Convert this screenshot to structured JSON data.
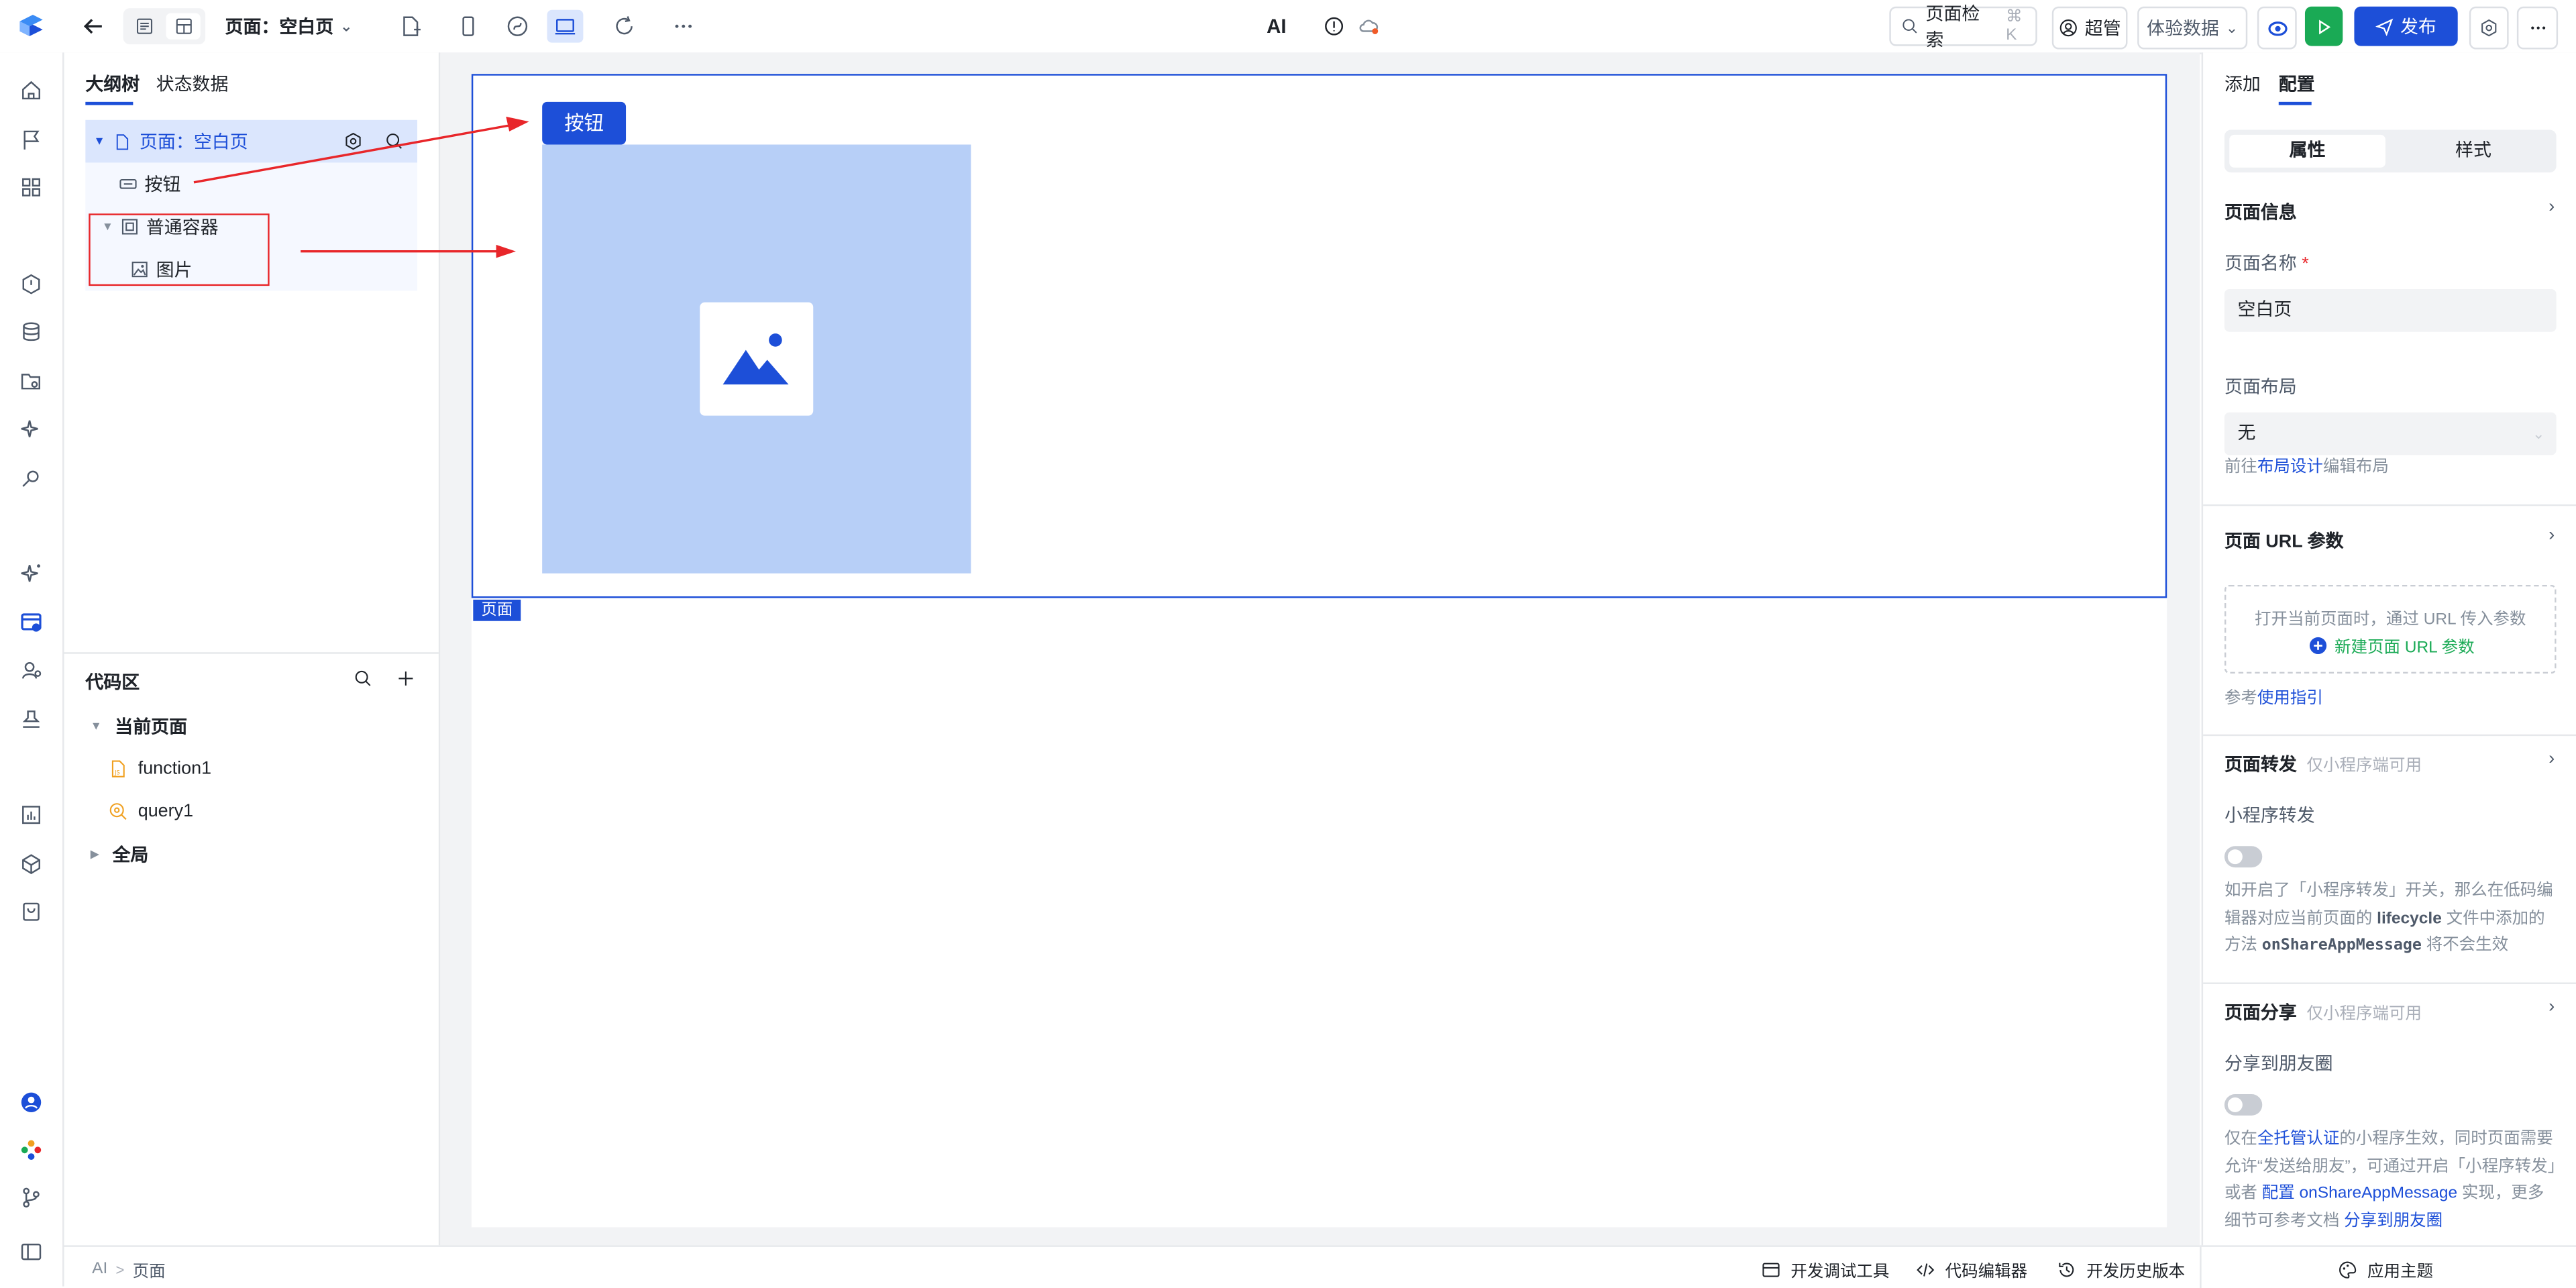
{
  "topbar": {
    "page_selector": "页面：空白页",
    "ai_label": "AI",
    "search_label": "页面检索",
    "search_shortcut": "⌘ K",
    "user_label": "超管",
    "data_mode": "体验数据",
    "publish_label": "发布"
  },
  "outline": {
    "tabs": [
      "大纲树",
      "状态数据"
    ],
    "tree": {
      "page": "页面：空白页",
      "button": "按钮",
      "container": "普通容器",
      "image": "图片"
    }
  },
  "code": {
    "title": "代码区",
    "current_page": "当前页面",
    "items": [
      "function1",
      "query1"
    ],
    "global": "全局"
  },
  "canvas": {
    "button_label": "按钮",
    "page_tag": "页面"
  },
  "right": {
    "tabs": [
      "添加",
      "配置"
    ],
    "segments": [
      "属性",
      "样式"
    ],
    "page_info": "页面信息",
    "page_name_label": "页面名称",
    "page_name_required": "*",
    "page_name_value": "空白页",
    "layout_label": "页面布局",
    "layout_value": "无",
    "layout_help_prefix": "前往",
    "layout_help_link": "布局设计",
    "layout_help_suffix": "编辑布局",
    "url_params_title": "页面 URL 参数",
    "url_params_hint": "打开当前页面时，通过 URL 传入参数",
    "url_params_new": "新建页面 URL 参数",
    "ref_prefix": "参考",
    "ref_link": "使用指引",
    "forward_title": "页面转发",
    "forward_note": "仅小程序端可用",
    "forward_label": "小程序转发",
    "forward_help_1": "如开启了「小程序转发」开关，那么在低码编辑器对应当前页面的 ",
    "forward_help_bold1": "lifecycle",
    "forward_help_2": " 文件中添加的方法 ",
    "forward_help_bold2": "onShareAppMessage",
    "forward_help_3": " 将不会生效",
    "share_title": "页面分享",
    "share_note": "仅小程序端可用",
    "share_label": "分享到朋友圈",
    "share_help_1": "仅在",
    "share_help_link1": "全托管认证",
    "share_help_2": "的小程序生效，同时页面需要允许“发送给朋友”，可通过开启「小程序转发」或者 ",
    "share_help_link2": "配置 onShareAppMessage",
    "share_help_3": " 实现，更多细节可参考文档 ",
    "share_help_link3": "分享到朋友圈"
  },
  "statusbar": {
    "crumb_root": "AI",
    "crumb_sep": ">",
    "crumb_page": "页面",
    "debug_tools": "开发调试工具",
    "code_editor": "代码编辑器",
    "history": "开发历史版本",
    "theme": "应用主题"
  },
  "colors": {
    "primary": "#1d4fd8",
    "publish_green": "#1aaa55",
    "annotation_red": "#e8262a",
    "placeholder_blue": "#b7cff7"
  }
}
